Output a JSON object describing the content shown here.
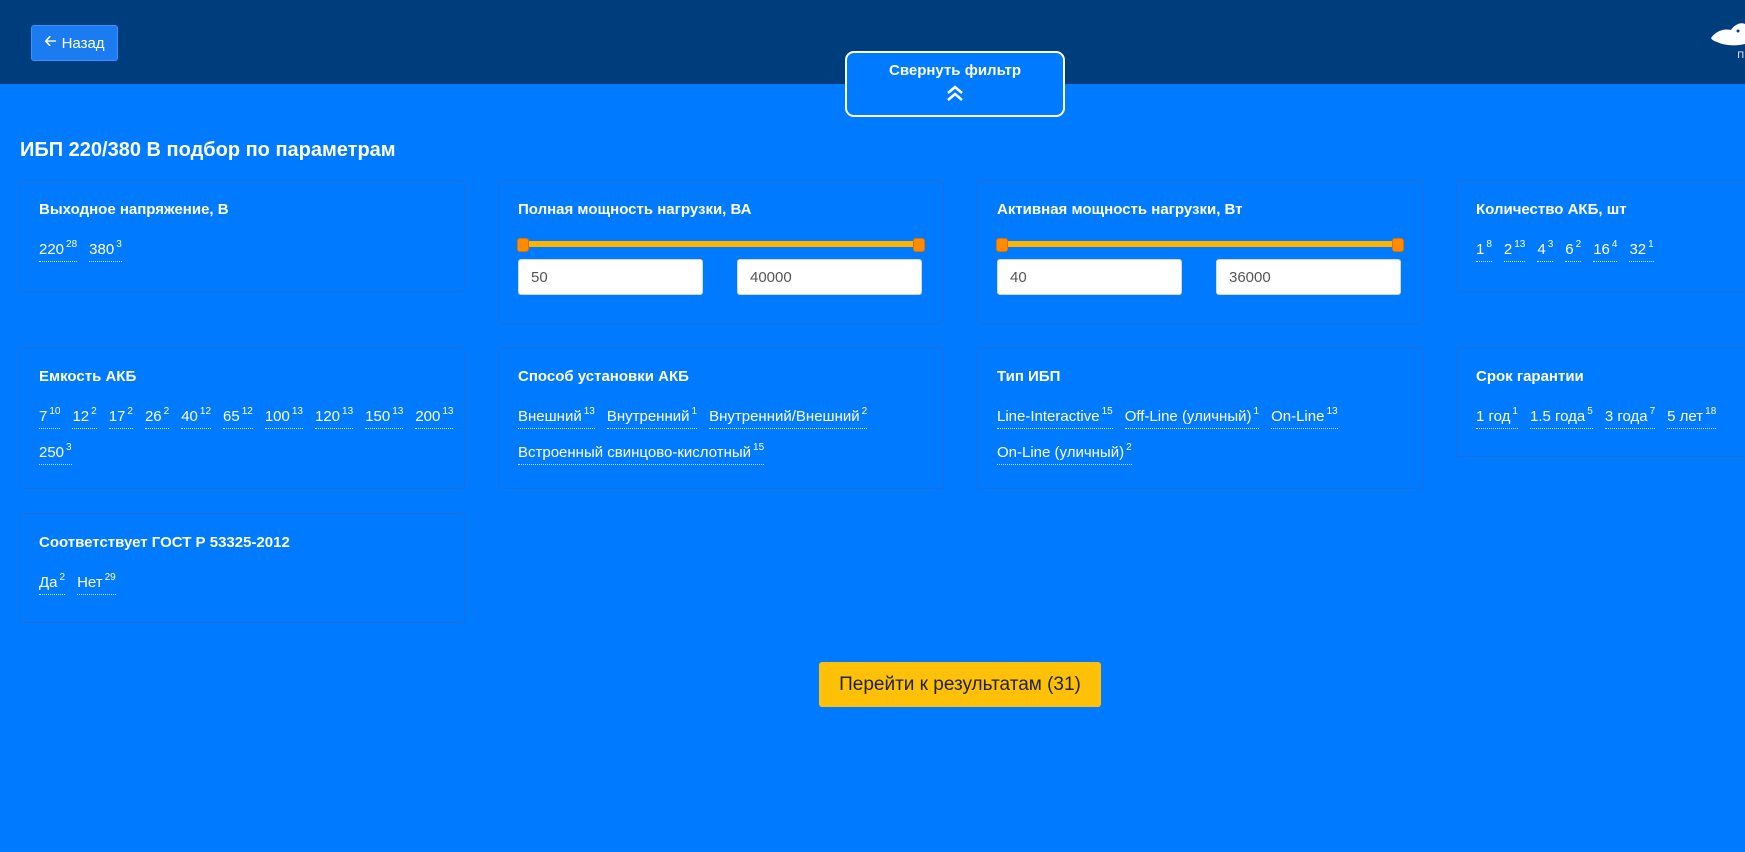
{
  "header": {
    "back_label": "Назад",
    "collapse_label": "Свернуть фильтр",
    "logo_text": "П"
  },
  "page_title": "ИБП 220/380 В подбор по параметрам",
  "filters": {
    "voltage": {
      "title": "Выходное напряжение, В",
      "options": [
        {
          "label": "220",
          "count": "28"
        },
        {
          "label": "380",
          "count": "3"
        }
      ]
    },
    "full_power": {
      "title": "Полная мощность нагрузки, ВА",
      "min": "50",
      "max": "40000",
      "min_fraction": 0,
      "max_fraction": 1
    },
    "active_power": {
      "title": "Активная мощность нагрузки, Вт",
      "min": "40",
      "max": "36000",
      "min_fraction": 0,
      "max_fraction": 1
    },
    "battery_count": {
      "title": "Количество АКБ, шт",
      "options": [
        {
          "label": "1",
          "count": "8"
        },
        {
          "label": "2",
          "count": "13"
        },
        {
          "label": "4",
          "count": "3"
        },
        {
          "label": "6",
          "count": "2"
        },
        {
          "label": "16",
          "count": "4"
        },
        {
          "label": "32",
          "count": "1"
        }
      ]
    },
    "battery_capacity": {
      "title": "Емкость АКБ",
      "options": [
        {
          "label": "7",
          "count": "10"
        },
        {
          "label": "12",
          "count": "2"
        },
        {
          "label": "17",
          "count": "2"
        },
        {
          "label": "26",
          "count": "2"
        },
        {
          "label": "40",
          "count": "12"
        },
        {
          "label": "65",
          "count": "12"
        },
        {
          "label": "100",
          "count": "13"
        },
        {
          "label": "120",
          "count": "13"
        },
        {
          "label": "150",
          "count": "13"
        },
        {
          "label": "200",
          "count": "13"
        },
        {
          "label": "250",
          "count": "3"
        }
      ]
    },
    "battery_mount": {
      "title": "Способ установки АКБ",
      "options": [
        {
          "label": "Внешний",
          "count": "13"
        },
        {
          "label": "Внутренний",
          "count": "1"
        },
        {
          "label": "Внутренний/Внешний",
          "count": "2"
        },
        {
          "label": "Встроенный свинцово-кислотный",
          "count": "15"
        }
      ]
    },
    "ups_type": {
      "title": "Тип ИБП",
      "options": [
        {
          "label": "Line-Interactive",
          "count": "15"
        },
        {
          "label": "Off-Line (уличный)",
          "count": "1"
        },
        {
          "label": "On-Line",
          "count": "13"
        },
        {
          "label": "On-Line (уличный)",
          "count": "2"
        }
      ]
    },
    "warranty": {
      "title": "Срок гарантии",
      "options": [
        {
          "label": "1 год",
          "count": "1"
        },
        {
          "label": "1.5 года",
          "count": "5"
        },
        {
          "label": "3 года",
          "count": "7"
        },
        {
          "label": "5 лет",
          "count": "18"
        }
      ]
    },
    "gost": {
      "title": "Соответствует ГОСТ Р 53325-2012",
      "options": [
        {
          "label": "Да",
          "count": "2"
        },
        {
          "label": "Нет",
          "count": "29"
        }
      ]
    }
  },
  "results_button": "Перейти к результатам (31)",
  "colors": {
    "background": "#007bff",
    "header": "#003d7d",
    "accent": "#ffc107",
    "slider_track": "#ffb300",
    "slider_handle": "#ff8c00"
  }
}
